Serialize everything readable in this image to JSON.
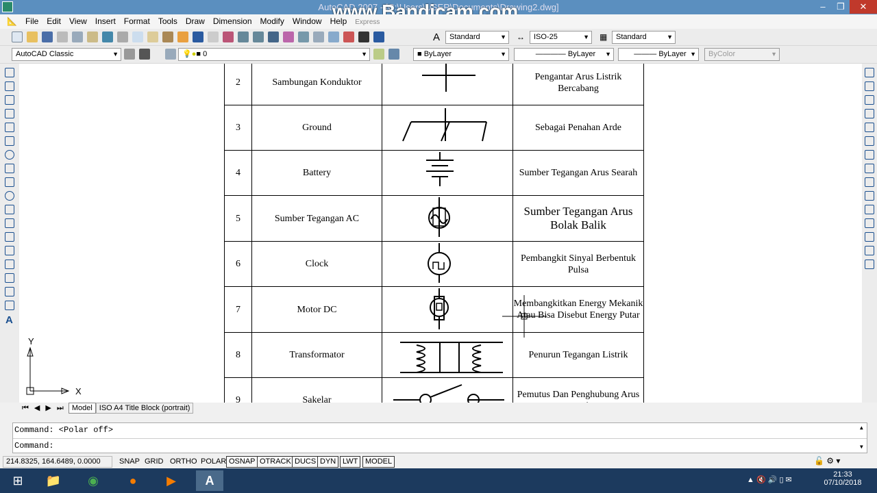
{
  "window": {
    "title": "AutoCAD 2007 - [C:\\Users\\USER\\Documents\\Drawing2.dwg]",
    "watermark": "www.Bandicam.com",
    "minimize": "–",
    "restore": "❐",
    "close": "✕"
  },
  "menu": [
    "File",
    "Edit",
    "View",
    "Insert",
    "Format",
    "Tools",
    "Draw",
    "Dimension",
    "Modify",
    "Window",
    "Help",
    "Express"
  ],
  "toolbar": {
    "text_style": "Standard",
    "dim_style": "ISO-25",
    "table_style": "Standard",
    "workspace": "AutoCAD Classic",
    "layer": "0",
    "color": "ByLayer",
    "linetype": "ByLayer",
    "lineweight": "ByLayer",
    "plotstyle": "ByColor"
  },
  "table": {
    "rows": [
      {
        "no": "2",
        "name": "Sambungan Konduktor",
        "symbol": "junction",
        "desc": "Pengantar Arus Listrik Bercabang"
      },
      {
        "no": "3",
        "name": "Ground",
        "symbol": "ground",
        "desc": "Sebagai Penahan Arde"
      },
      {
        "no": "4",
        "name": "Battery",
        "symbol": "battery",
        "desc": "Sumber Tegangan Arus Searah"
      },
      {
        "no": "5",
        "name": "Sumber Tegangan AC",
        "symbol": "ac-source",
        "desc": "Sumber Tegangan Arus Bolak Balik"
      },
      {
        "no": "6",
        "name": "Clock",
        "symbol": "clock",
        "desc": "Pembangkit Sinyal Berbentuk Pulsa"
      },
      {
        "no": "7",
        "name": "Motor DC",
        "symbol": "motor-dc",
        "desc": "Membangkitkan Energy Mekanik Atau Bisa Disebut Energy Putar"
      },
      {
        "no": "8",
        "name": "Transformator",
        "symbol": "transformer",
        "desc": "Penurun Tegangan Listrik"
      },
      {
        "no": "9",
        "name": "Sakelar",
        "symbol": "switch",
        "desc": "Pemutus Dan Penghubung Arus Listrik"
      }
    ]
  },
  "ucs": {
    "x": "X",
    "y": "Y"
  },
  "tabs": [
    "Model",
    "ISO A4 Title Block (portrait)"
  ],
  "command": {
    "line1": "Command:  <Polar off>",
    "line2": "Command:"
  },
  "status": {
    "coords": "214.8325, 164.6489, 0.0000",
    "buttons": [
      {
        "label": "SNAP",
        "on": false
      },
      {
        "label": "GRID",
        "on": false
      },
      {
        "label": "ORTHO",
        "on": false
      },
      {
        "label": "POLAR",
        "on": false
      },
      {
        "label": "OSNAP",
        "on": true
      },
      {
        "label": "OTRACK",
        "on": true
      },
      {
        "label": "DUCS",
        "on": true
      },
      {
        "label": "DYN",
        "on": true
      },
      {
        "label": "LWT",
        "on": true
      },
      {
        "label": "MODEL",
        "on": true
      }
    ]
  },
  "taskbar": {
    "time": "21:33",
    "date": "07/10/2018",
    "apps": [
      "windows-start",
      "file-explorer",
      "chrome",
      "firefox",
      "media-player",
      "autocad"
    ]
  }
}
